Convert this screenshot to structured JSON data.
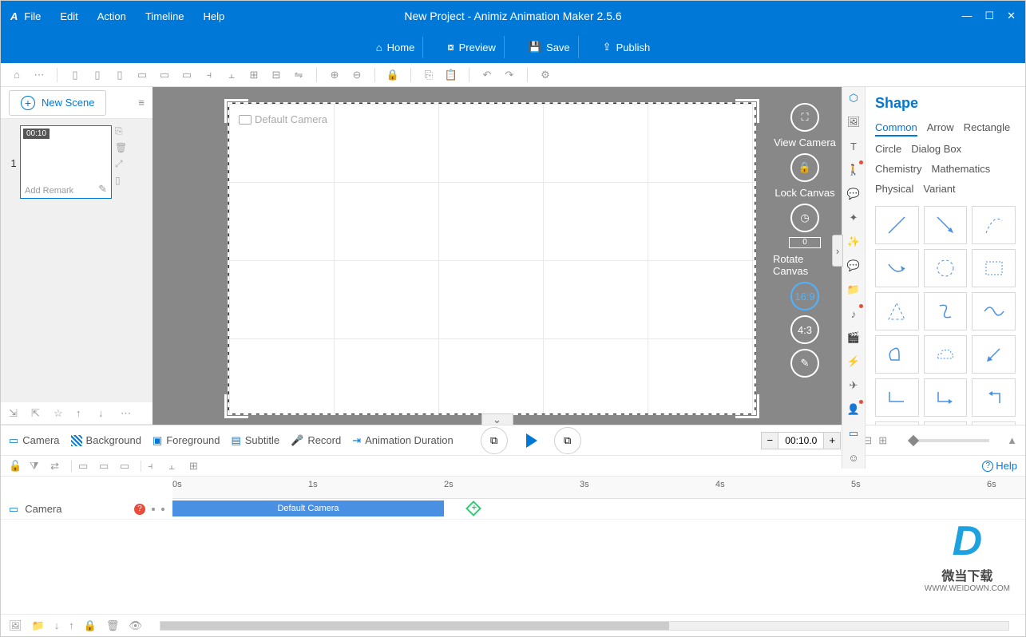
{
  "title": "New Project - Animiz Animation Maker 2.5.6",
  "menus": [
    "File",
    "Edit",
    "Action",
    "Timeline",
    "Help"
  ],
  "ribbon": [
    {
      "icon": "home",
      "label": "Home"
    },
    {
      "icon": "preview",
      "label": "Preview"
    },
    {
      "icon": "save",
      "label": "Save"
    },
    {
      "icon": "publish",
      "label": "Publish"
    }
  ],
  "newscene": "New Scene",
  "scene": {
    "time": "00:10",
    "remark": "Add Remark",
    "num": "1"
  },
  "canvas": {
    "camera": "Default Camera",
    "viewcam": "View Camera",
    "lockcan": "Lock Canvas",
    "rotcan": "Rotate Canvas",
    "rotval": "0",
    "r169": "16:9",
    "r43": "4:3"
  },
  "shape": {
    "title": "Shape",
    "tabs": [
      "Common",
      "Arrow",
      "Rectangle",
      "Circle",
      "Dialog Box",
      "Chemistry",
      "Mathematics",
      "Physical",
      "Variant"
    ]
  },
  "prop": {
    "camera": "Camera",
    "bg": "Background",
    "fg": "Foreground",
    "sub": "Subtitle",
    "rec": "Record",
    "dur": "Animation Duration"
  },
  "time": "00:10.0",
  "help": "Help",
  "ruler": [
    "0s",
    "1s",
    "2s",
    "3s",
    "4s",
    "5s",
    "6s"
  ],
  "track": {
    "name": "Camera",
    "clip": "Default Camera"
  },
  "watermark": {
    "cn": "微当下载",
    "url": "WWW.WEIDOWN.COM"
  }
}
